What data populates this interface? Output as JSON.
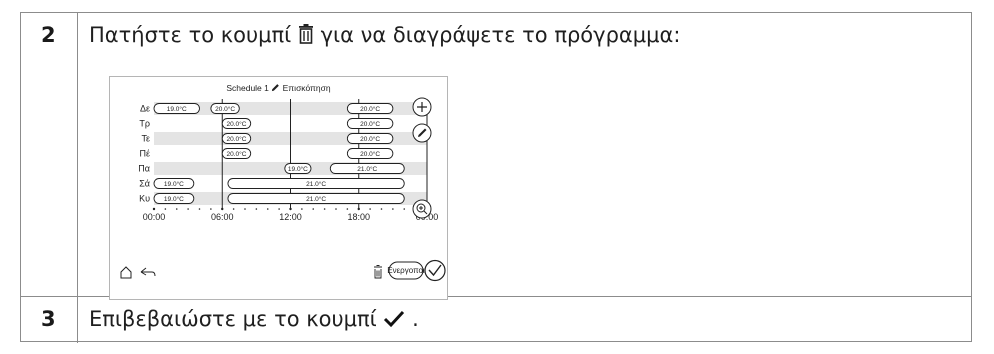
{
  "steps": [
    {
      "number": "2",
      "text": "Πατήστε το κουμπί",
      "icon": "trash-icon",
      "text_after": "για να διαγράψετε το πρόγραμμα:"
    },
    {
      "number": "3",
      "text": "Επιβεβαιώστε με το κουμπί",
      "icon": "check-icon",
      "text_after": "."
    }
  ],
  "screen": {
    "title": "Schedule 1",
    "title_icon": "pencil-icon",
    "title_suffix": "Επισκόπηση",
    "days": [
      "Δε",
      "Τρ",
      "Τε",
      "Πέ",
      "Πα",
      "Σά",
      "Κυ"
    ],
    "time_ticks": [
      "00:00",
      "06:00",
      "12:00",
      "18:00",
      "00:00"
    ],
    "blocks": [
      [
        {
          "start": 0.0,
          "end": 4.0,
          "label": "19.0°C"
        },
        {
          "start": 5.0,
          "end": 7.5,
          "label": "20.0°C"
        },
        {
          "start": 17.0,
          "end": 21.0,
          "label": "20.0°C"
        }
      ],
      [
        {
          "start": 6.0,
          "end": 8.5,
          "label": "20.0°C"
        },
        {
          "start": 17.0,
          "end": 21.0,
          "label": "20.0°C"
        }
      ],
      [
        {
          "start": 6.0,
          "end": 8.5,
          "label": "20.0°C"
        },
        {
          "start": 17.0,
          "end": 21.0,
          "label": "20.0°C"
        }
      ],
      [
        {
          "start": 6.0,
          "end": 8.5,
          "label": "20.0°C"
        },
        {
          "start": 17.0,
          "end": 21.0,
          "label": "20.0°C"
        }
      ],
      [
        {
          "start": 11.5,
          "end": 13.8,
          "label": "19.0°C"
        },
        {
          "start": 15.5,
          "end": 22.0,
          "label": "21.0°C"
        }
      ],
      [
        {
          "start": 0.0,
          "end": 3.5,
          "label": "19.0°C"
        },
        {
          "start": 6.5,
          "end": 22.0,
          "label": "21.0°C"
        }
      ],
      [
        {
          "start": 0.0,
          "end": 3.5,
          "label": "19.0°C"
        },
        {
          "start": 6.5,
          "end": 22.0,
          "label": "21.0°C"
        }
      ]
    ],
    "side_buttons": [
      "add-icon",
      "edit-icon",
      "zoom-icon"
    ],
    "bottom": {
      "home_icon": "home-icon",
      "back_icon": "back-icon",
      "delete_icon": "trash-icon",
      "activate_label": "Ενεργοποι",
      "confirm_icon": "check-icon"
    }
  }
}
